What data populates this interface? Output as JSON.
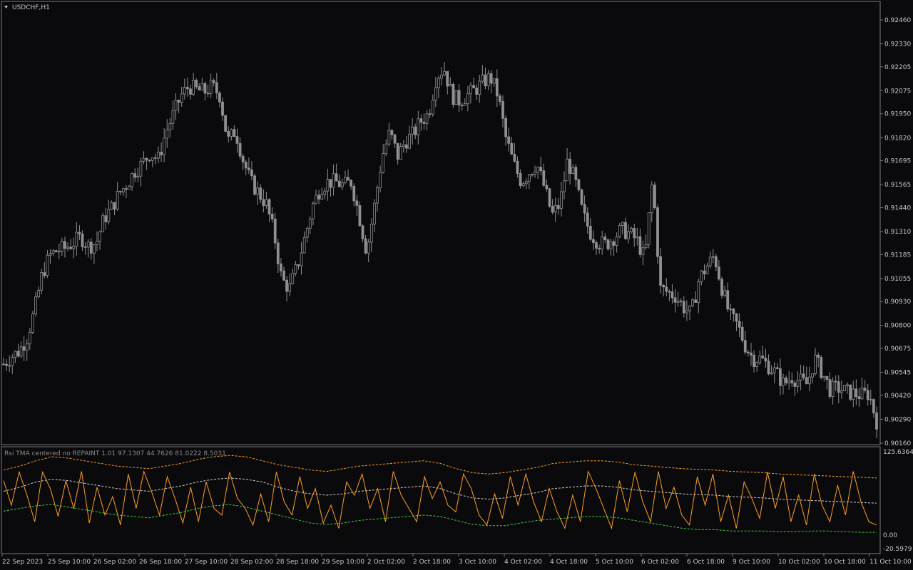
{
  "window": {
    "symbol_title": "USDCHF,H1",
    "indicator_title": "Rsi TMA centered no REPAINT 1.01 97.1307 44.7626 81.0222 8.5031"
  },
  "colors": {
    "background": "#0a0a0d",
    "frame": "#7a7a7a",
    "candle": "#8e8e94",
    "rsi": "#ff9f1c",
    "upper_band": "#ff9f1c",
    "middle_band": "#d0d0d0",
    "lower_band": "#3ad13a",
    "text": "#c8c8c8"
  },
  "chart_data": [
    {
      "type": "line",
      "subtype": "candlestick",
      "symbol": "USDCHF",
      "timeframe": "H1",
      "ylim": [
        0.9016,
        0.9246
      ],
      "y_ticks": [
        "0.92460",
        "0.92330",
        "0.92205",
        "0.92075",
        "0.91950",
        "0.91820",
        "0.91695",
        "0.91565",
        "0.91440",
        "0.91310",
        "0.91185",
        "0.91055",
        "0.90930",
        "0.90800",
        "0.90675",
        "0.90545",
        "0.90420",
        "0.90290",
        "0.90160"
      ],
      "x_ticks": [
        "22 Sep 2023",
        "25 Sep 10:00",
        "26 Sep 02:00",
        "26 Sep 18:00",
        "27 Sep 10:00",
        "28 Sep 02:00",
        "28 Sep 18:00",
        "29 Sep 10:00",
        "2 Oct 02:00",
        "2 Oct 18:00",
        "3 Oct 10:00",
        "4 Oct 02:00",
        "4 Oct 18:00",
        "5 Oct 10:00",
        "6 Oct 02:00",
        "6 Oct 18:00",
        "9 Oct 10:00",
        "10 Oct 02:00",
        "10 Oct 18:00",
        "11 Oct 10:00"
      ],
      "close_path": [
        0.9059,
        0.9063,
        0.9066,
        0.9073,
        0.9088,
        0.9108,
        0.9118,
        0.9121,
        0.9122,
        0.9125,
        0.9128,
        0.9123,
        0.9125,
        0.9138,
        0.9144,
        0.9152,
        0.9157,
        0.9164,
        0.9168,
        0.9174,
        0.917,
        0.9185,
        0.9195,
        0.9205,
        0.921,
        0.9208,
        0.9207,
        0.921,
        0.9205,
        0.918,
        0.9186,
        0.917,
        0.9158,
        0.9152,
        0.9146,
        0.913,
        0.9105,
        0.91,
        0.9112,
        0.9128,
        0.9145,
        0.9155,
        0.9158,
        0.9158,
        0.9156,
        0.9158,
        0.914,
        0.912,
        0.9145,
        0.9172,
        0.9185,
        0.9172,
        0.918,
        0.9184,
        0.9191,
        0.9195,
        0.9215,
        0.922,
        0.9205,
        0.9202,
        0.9205,
        0.9208,
        0.9212,
        0.9215,
        0.9205,
        0.9182,
        0.9168,
        0.9158,
        0.9163,
        0.9168,
        0.9155,
        0.914,
        0.9146,
        0.917,
        0.9158,
        0.914,
        0.913,
        0.9125,
        0.9124,
        0.9128,
        0.9132,
        0.913,
        0.9126,
        0.9116,
        0.916,
        0.91,
        0.9098,
        0.9096,
        0.909,
        0.9086,
        0.9105,
        0.9112,
        0.9118,
        0.91,
        0.9085,
        0.908,
        0.9069,
        0.9062,
        0.9062,
        0.9058,
        0.9054,
        0.9048,
        0.9052,
        0.905,
        0.9048,
        0.9062,
        0.9054,
        0.9045,
        0.9046,
        0.9044,
        0.9043,
        0.9042,
        0.9043,
        0.9028
      ]
    },
    {
      "type": "line",
      "name": "Rsi TMA centered no REPAINT 1.01",
      "values_shown": [
        97.1307,
        44.7626,
        81.0222,
        8.5031
      ],
      "ylim": [
        -20.5979,
        125.6364
      ],
      "y_ticks": [
        "125.6364",
        "0.00",
        "-20.5979"
      ],
      "rsi_path": [
        82,
        45,
        95,
        60,
        20,
        95,
        70,
        28,
        82,
        40,
        96,
        18,
        72,
        30,
        58,
        15,
        92,
        40,
        96,
        65,
        30,
        88,
        55,
        18,
        72,
        20,
        80,
        40,
        30,
        95,
        55,
        40,
        15,
        62,
        20,
        95,
        50,
        30,
        88,
        40,
        70,
        18,
        45,
        10,
        80,
        60,
        92,
        40,
        70,
        20,
        96,
        60,
        40,
        20,
        88,
        55,
        80,
        45,
        35,
        92,
        70,
        30,
        15,
        62,
        25,
        88,
        45,
        92,
        50,
        20,
        70,
        35,
        10,
        60,
        20,
        96,
        70,
        40,
        10,
        82,
        35,
        95,
        50,
        20,
        96,
        40,
        72,
        30,
        15,
        88,
        45,
        92,
        20,
        60,
        10,
        80,
        55,
        25,
        95,
        40,
        88,
        20,
        60,
        15,
        92,
        45,
        20,
        75,
        30,
        96,
        50,
        20,
        15
      ],
      "upper_path": [
        98,
        104,
        112,
        118,
        116,
        112,
        108,
        104,
        102,
        100,
        104,
        108,
        114,
        118,
        120,
        118,
        112,
        106,
        102,
        98,
        96,
        100,
        104,
        106,
        108,
        110,
        112,
        108,
        100,
        94,
        92,
        94,
        98,
        102,
        108,
        110,
        112,
        112,
        110,
        106,
        104,
        102,
        100,
        99,
        98,
        96,
        95,
        94,
        92,
        91,
        90,
        89,
        88,
        87,
        86
      ],
      "middle_path": [
        66,
        72,
        80,
        84,
        82,
        78,
        74,
        70,
        68,
        66,
        70,
        74,
        80,
        84,
        86,
        84,
        80,
        72,
        66,
        62,
        60,
        62,
        66,
        68,
        70,
        72,
        74,
        70,
        62,
        56,
        54,
        56,
        60,
        64,
        70,
        72,
        74,
        74,
        72,
        68,
        66,
        64,
        62,
        61,
        60,
        58,
        57,
        56,
        54,
        53,
        52,
        51,
        50,
        49,
        48
      ],
      "lower_path": [
        36,
        40,
        44,
        46,
        42,
        38,
        34,
        30,
        28,
        26,
        30,
        34,
        40,
        44,
        46,
        42,
        36,
        30,
        24,
        18,
        16,
        18,
        22,
        24,
        26,
        28,
        30,
        28,
        22,
        16,
        14,
        14,
        18,
        22,
        24,
        26,
        28,
        28,
        26,
        22,
        18,
        14,
        10,
        8,
        8,
        6,
        6,
        6,
        5,
        5,
        6,
        6,
        5,
        4,
        4
      ]
    }
  ]
}
